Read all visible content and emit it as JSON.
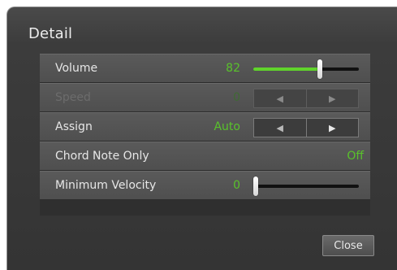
{
  "dialog": {
    "title": "Detail",
    "close_label": "Close"
  },
  "rows": [
    {
      "label": "Volume",
      "value": "82",
      "control": "slider",
      "level": 0.64,
      "enabled": true
    },
    {
      "label": "Speed",
      "value": "0",
      "control": "stepper",
      "enabled": false
    },
    {
      "label": "Assign",
      "value": "Auto",
      "control": "stepper",
      "enabled": true
    },
    {
      "label": "Chord Note Only",
      "value": "Off",
      "control": "none",
      "enabled": true
    },
    {
      "label": "Minimum Velocity",
      "value": "0",
      "control": "slider",
      "level": 0.0,
      "enabled": true
    }
  ],
  "stepper_icons": {
    "left": "left-arrow-icon",
    "right": "right-arrow-icon"
  },
  "colors": {
    "value_green": "#59c22b",
    "slider_fill": "#60d42b",
    "background": "#343434"
  }
}
